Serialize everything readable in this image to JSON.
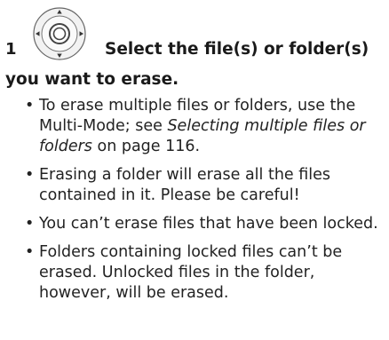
{
  "step": {
    "number": "1",
    "icon": "multi-controller-dial-icon",
    "title_line1": "Select the file(s) or folder(s)",
    "title_line2": "you want to erase."
  },
  "bullets": [
    {
      "before": "To erase multiple files or folders, use the Multi-Mode; see ",
      "ref": "Selecting multiple files or folders",
      "after": " on page 116."
    },
    {
      "text": "Erasing a folder will erase all the files contained in it. Please be careful!"
    },
    {
      "text": "You can’t erase files that have been locked."
    },
    {
      "text": "Folders containing locked files can’t be erased. Unlocked files in the folder, however, will be erased."
    }
  ],
  "colors": {
    "text": "#1a1a1a",
    "icon_stroke": "#555555"
  }
}
